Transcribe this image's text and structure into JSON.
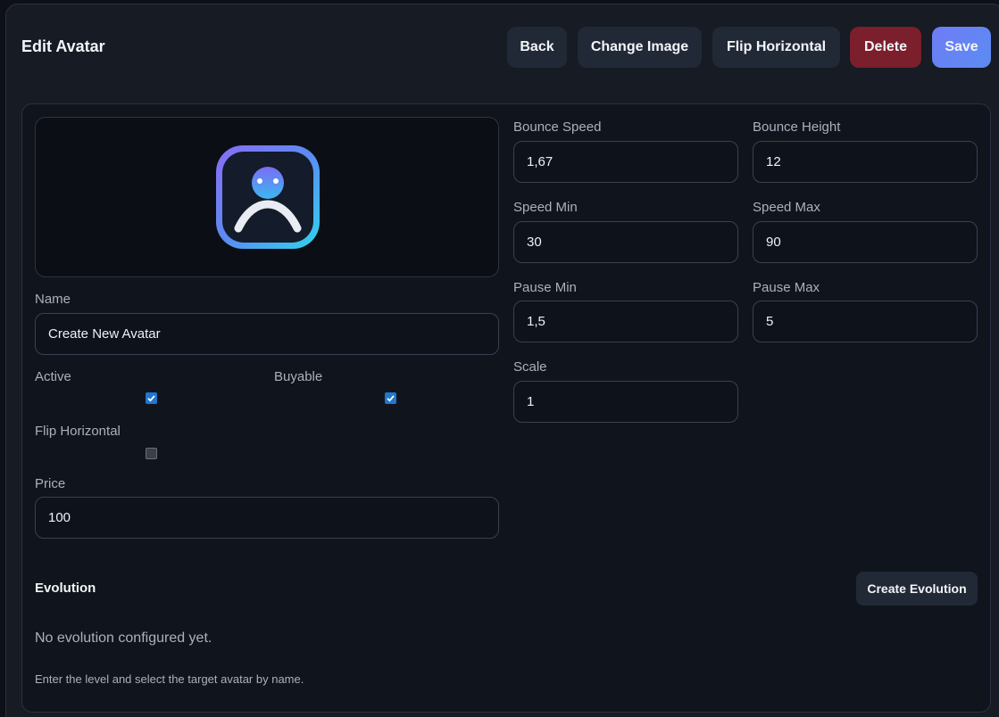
{
  "header": {
    "title": "Edit Avatar",
    "buttons": {
      "back": "Back",
      "change_image": "Change Image",
      "flip_horizontal": "Flip Horizontal",
      "delete": "Delete",
      "save": "Save"
    }
  },
  "preview": {
    "icon": "avatar-person-icon"
  },
  "form": {
    "name": {
      "label": "Name",
      "value": "Create New Avatar"
    },
    "active": {
      "label": "Active",
      "checked": true
    },
    "buyable": {
      "label": "Buyable",
      "checked": true
    },
    "flip_horizontal": {
      "label": "Flip Horizontal",
      "checked": false
    },
    "price": {
      "label": "Price",
      "value": "100"
    },
    "bounce_speed": {
      "label": "Bounce Speed",
      "value": "1,67"
    },
    "bounce_height": {
      "label": "Bounce Height",
      "value": "12"
    },
    "speed_min": {
      "label": "Speed Min",
      "value": "30"
    },
    "speed_max": {
      "label": "Speed Max",
      "value": "90"
    },
    "pause_min": {
      "label": "Pause Min",
      "value": "1,5"
    },
    "pause_max": {
      "label": "Pause Max",
      "value": "5"
    },
    "scale": {
      "label": "Scale",
      "value": "1"
    }
  },
  "evolution": {
    "title": "Evolution",
    "create_button": "Create Evolution",
    "empty_text": "No evolution configured yet.",
    "hint": "Enter the level and select the target avatar by name."
  },
  "colors": {
    "accent": "#6f7cf5",
    "danger": "#7a1f2b",
    "checkbox": "#1f77d0"
  }
}
